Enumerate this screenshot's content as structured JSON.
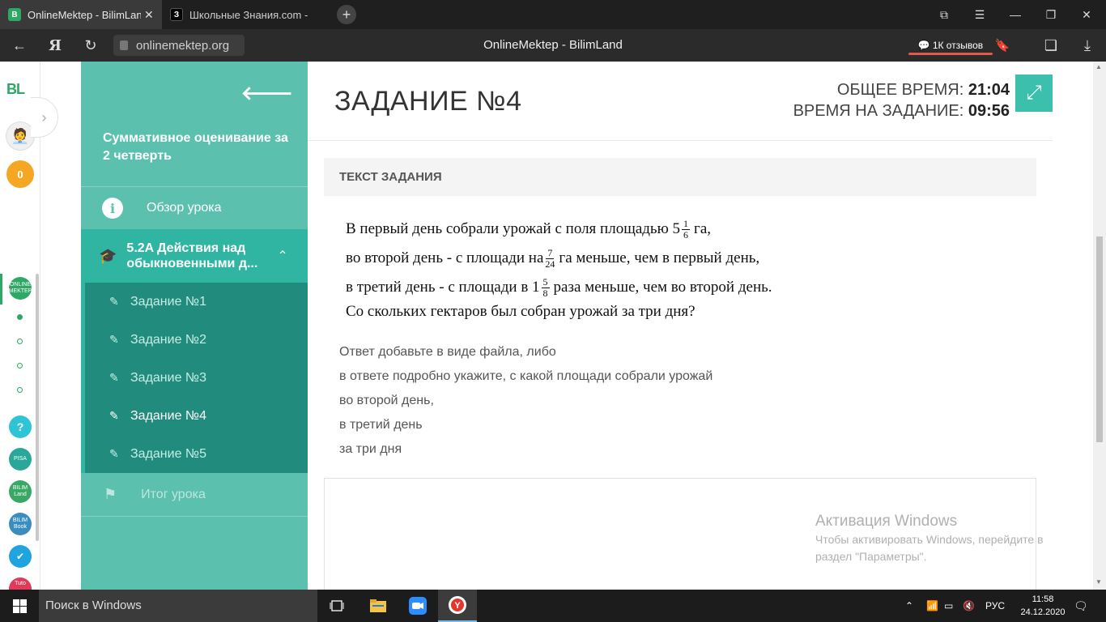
{
  "browser": {
    "tabs": [
      {
        "label": "OnlineMektep - BilimLand",
        "favicon": "B"
      },
      {
        "label": "Школьные Знания.com - Вопрос",
        "favicon": "З"
      }
    ],
    "url": "onlinemektep.org",
    "page_title": "OnlineMektep - BilimLand",
    "reviews": "1К отзывов"
  },
  "rail": {
    "logo": "BL",
    "coins": "0",
    "apps": [
      {
        "name": "online-mektep",
        "label": "ONLINE MEKTEP",
        "color": "#2fa866"
      },
      {
        "name": "help",
        "label": "?",
        "color": "#2ec4d6"
      },
      {
        "name": "pisa",
        "label": "PISA",
        "color": "#2aa79b"
      },
      {
        "name": "bilimland",
        "label": "BILIM Land",
        "color": "#3aa865"
      },
      {
        "name": "bilimbook",
        "label": "BILIM Book",
        "color": "#3a8dbf"
      },
      {
        "name": "tasks",
        "label": "✔",
        "color": "#1fa4e0"
      },
      {
        "name": "tuto",
        "label": "Tuto",
        "color": "#e03a5a"
      }
    ]
  },
  "sidebar": {
    "course_title": "Суммативное оценивание за 2 четверть",
    "overview": "Обзор урока",
    "lesson": "5.2A Действия над обыкновенными д...",
    "tasks": [
      "Задание №1",
      "Задание №2",
      "Задание №3",
      "Задание №4",
      "Задание №5"
    ],
    "current_task_index": 3,
    "summary": "Итог урока"
  },
  "main": {
    "title": "ЗАДАНИЕ №4",
    "total_time_label": "ОБЩЕЕ ВРЕМЯ:",
    "total_time": "21:04",
    "task_time_label": "ВРЕМЯ НА ЗАДАНИЕ:",
    "task_time": "09:56",
    "section_head": "ТЕКСТ ЗАДАНИЯ",
    "problem": {
      "l1_pre": "В первый день собрали урожай с поля площадью 5",
      "f1_num": "1",
      "f1_den": "6",
      "l1_post": " га,",
      "l2_pre": "во второй день - с площади на ",
      "f2_num": "7",
      "f2_den": "24",
      "l2_post": "га меньше, чем в первый день,",
      "l3_pre": "в третий день - с площади в 1",
      "f3_num": "5",
      "f3_den": "8",
      "l3_post": " раза меньше, чем во второй день.",
      "l4": "Со скольких гектаров был собран урожай за три дня?"
    },
    "notes": [
      "Ответ добавьте в виде файла, либо",
      "в ответе подробно укажите, с какой площади собрали урожай",
      "во второй день,",
      "в третий день",
      "за три дня"
    ],
    "watermark_title": "Активация Windows",
    "watermark_text": "Чтобы активировать Windows, перейдите в раздел \"Параметры\"."
  },
  "taskbar": {
    "search_placeholder": "Поиск в Windows",
    "lang": "РУС",
    "time": "11:58",
    "date": "24.12.2020"
  }
}
